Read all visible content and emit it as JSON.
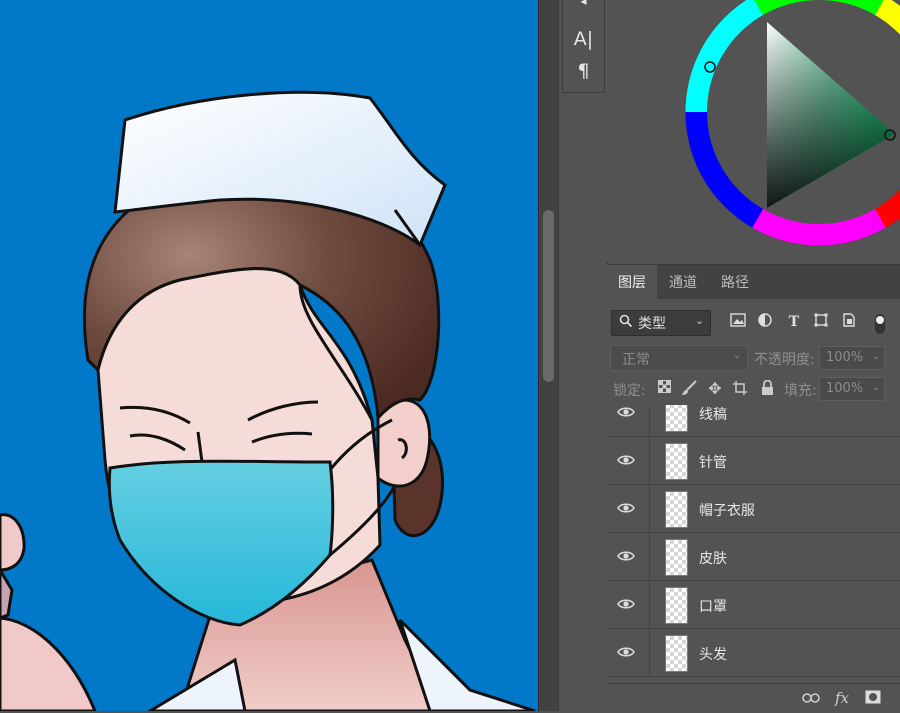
{
  "tools": {
    "text_tool": "A|",
    "paragraph_tool": "¶"
  },
  "layers_panel": {
    "tabs": [
      "图层",
      "通道",
      "路径"
    ],
    "filter": {
      "kind_label": "类型"
    },
    "blend_mode": "正常",
    "opacity_label": "不透明度:",
    "opacity_value": "100%",
    "lock_label": "锁定:",
    "fill_label": "填充:",
    "fill_value": "100%",
    "layers": [
      {
        "name": "线稿",
        "visible": true
      },
      {
        "name": "针管",
        "visible": true
      },
      {
        "name": "帽子衣服",
        "visible": true
      },
      {
        "name": "皮肤",
        "visible": true
      },
      {
        "name": "口罩",
        "visible": true
      },
      {
        "name": "头发",
        "visible": true
      }
    ]
  },
  "colors": {
    "canvas_background": "#0278c9",
    "panel_background": "#535353",
    "mask": "#3cc0dd",
    "hair": "#6e4a3e",
    "skin": "#f6dcd9",
    "cap": "#e6f1fc"
  },
  "icons": {
    "filter_icons": [
      "image-filter-icon",
      "adjustment-filter-icon",
      "type-filter-icon",
      "shape-filter-icon",
      "smart-object-filter-icon",
      "filter-toggle-icon"
    ],
    "lock_icons": [
      "lock-transparent-icon",
      "lock-paint-icon",
      "lock-position-icon",
      "lock-artboard-icon",
      "lock-all-icon"
    ],
    "bottom_icons": [
      "link-icon",
      "fx-icon",
      "mask-icon"
    ]
  }
}
